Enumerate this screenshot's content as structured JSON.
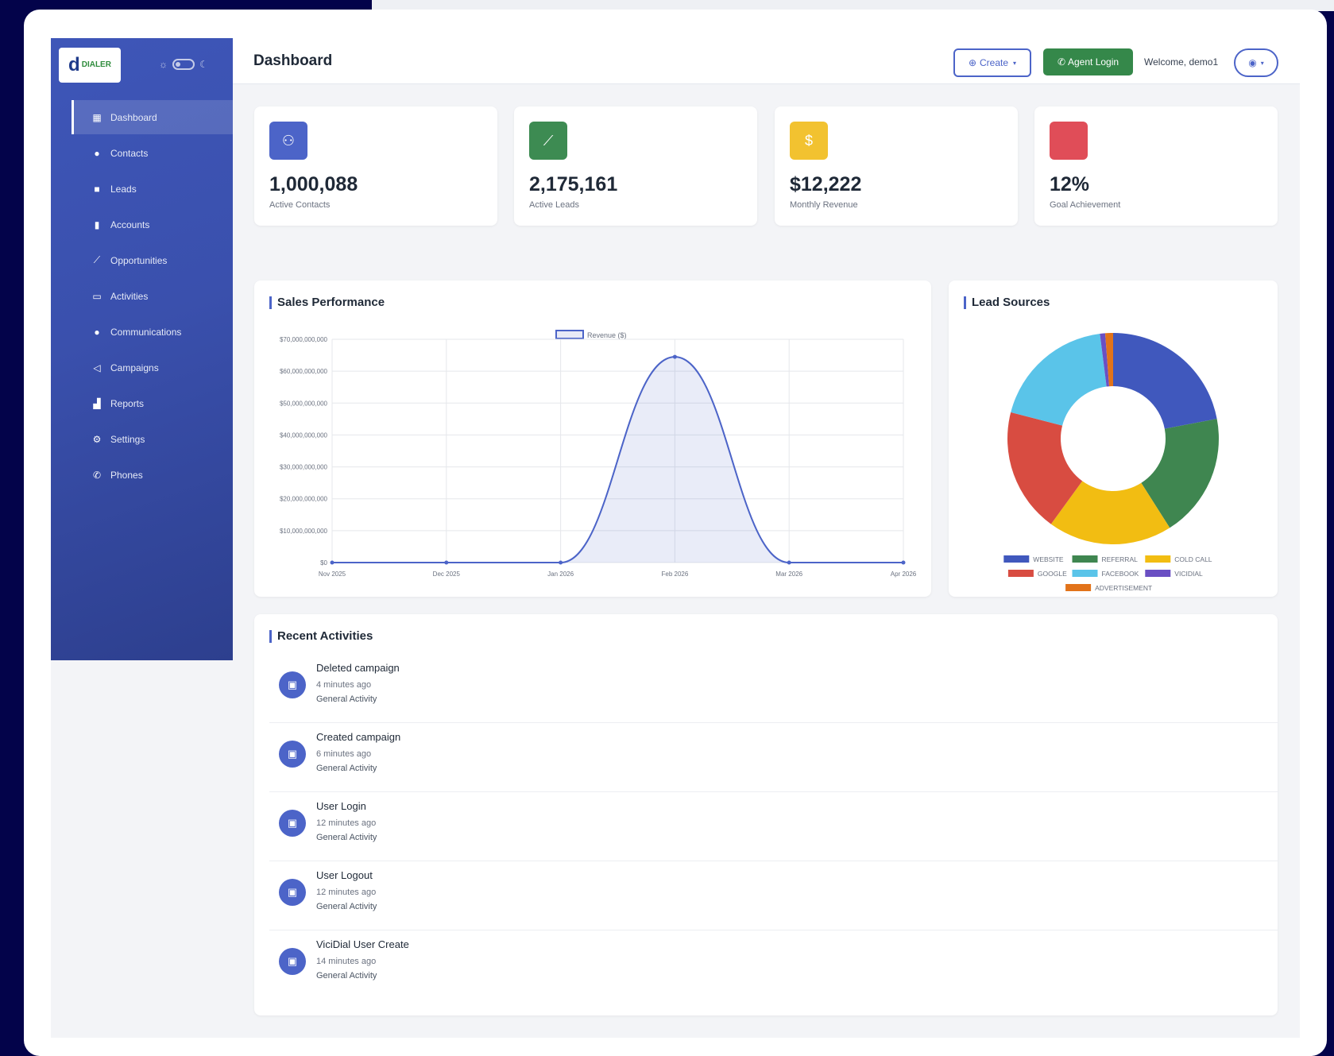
{
  "header": {
    "title": "Dashboard",
    "create_label": "Create",
    "agent_login_label": "Agent Login",
    "welcome": "Welcome, demo1"
  },
  "sidebar": {
    "logo_text": "DIALER",
    "items": [
      {
        "label": "Dashboard",
        "icon": "grid-icon",
        "active": true
      },
      {
        "label": "Contacts",
        "icon": "user-icon"
      },
      {
        "label": "Leads",
        "icon": "briefcase-icon"
      },
      {
        "label": "Accounts",
        "icon": "building-icon"
      },
      {
        "label": "Opportunities",
        "icon": "chart-line-icon"
      },
      {
        "label": "Activities",
        "icon": "calendar-icon"
      },
      {
        "label": "Communications",
        "icon": "chat-icon"
      },
      {
        "label": "Campaigns",
        "icon": "megaphone-icon"
      },
      {
        "label": "Reports",
        "icon": "bar-chart-icon"
      },
      {
        "label": "Settings",
        "icon": "gear-icon"
      },
      {
        "label": "Phones",
        "icon": "phone-icon"
      }
    ]
  },
  "stats": [
    {
      "value": "1,000,088",
      "label": "Active Contacts",
      "color": "#4c64c8",
      "icon": "users-icon"
    },
    {
      "value": "2,175,161",
      "label": "Active Leads",
      "color": "#3d8b52",
      "icon": "trend-icon"
    },
    {
      "value": "$12,222",
      "label": "Monthly Revenue",
      "color": "#f2c230",
      "icon": "dollar-icon"
    },
    {
      "value": "12%",
      "label": "Goal Achievement",
      "color": "#e04d58",
      "icon": "target-icon"
    }
  ],
  "sales": {
    "title": "Sales Performance",
    "legend": "Revenue ($)"
  },
  "lead_sources": {
    "title": "Lead Sources"
  },
  "chart_data": [
    {
      "type": "area",
      "title": "Sales Performance",
      "series": [
        {
          "name": "Revenue ($)",
          "values": [
            0,
            0,
            0,
            64500000000,
            0,
            0
          ]
        }
      ],
      "categories": [
        "Nov 2025",
        "Dec 2025",
        "Jan 2026",
        "Feb 2026",
        "Mar 2026",
        "Apr 2026"
      ],
      "yticks": [
        "$70,000,000,000",
        "$60,000,000,000",
        "$50,000,000,000",
        "$40,000,000,000",
        "$30,000,000,000",
        "$20,000,000,000",
        "$10,000,000,000",
        "$0"
      ],
      "ylim": [
        0,
        70000000000
      ],
      "grid": true,
      "legend": "top",
      "color": "#4c64c8"
    },
    {
      "type": "pie",
      "title": "Lead Sources",
      "donut": true,
      "categories": [
        "WEBSITE",
        "REFERRAL",
        "COLD CALL",
        "GOOGLE",
        "FACEBOOK",
        "VICIDIAL",
        "ADVERTISEMENT"
      ],
      "values": [
        22,
        19,
        19,
        19,
        19,
        0.8,
        1.2
      ],
      "colors": [
        "#4058bd",
        "#3f8650",
        "#f2bd12",
        "#d84c41",
        "#5ac4e9",
        "#6a4fc3",
        "#e2731a"
      ],
      "legend": "bottom"
    }
  ],
  "activities": {
    "title": "Recent Activities",
    "items": [
      {
        "title": "Deleted campaign",
        "time": "4 minutes ago",
        "category": "General Activity"
      },
      {
        "title": "Created campaign",
        "time": "6 minutes ago",
        "category": "General Activity"
      },
      {
        "title": "User Login",
        "time": "12 minutes ago",
        "category": "General Activity"
      },
      {
        "title": "User Logout",
        "time": "12 minutes ago",
        "category": "General Activity"
      },
      {
        "title": "ViciDial User Create",
        "time": "14 minutes ago",
        "category": "General Activity"
      }
    ]
  }
}
